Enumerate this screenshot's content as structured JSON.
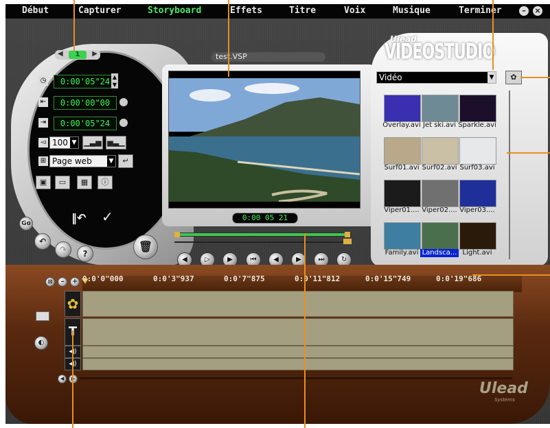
{
  "menu": {
    "items": [
      "Début",
      "Capturer",
      "Storyboard",
      "Effets",
      "Titre",
      "Voix",
      "Musique",
      "Terminer"
    ],
    "active": "Storyboard",
    "minimize_icon": "minimize-icon",
    "close_icon": "close-icon"
  },
  "project": {
    "filename": "test.VSP"
  },
  "controls": {
    "duration": "0:00'05\"24",
    "mark_in": "0:00'00\"00",
    "mark_out": "0:00'05\"24",
    "volume": "100",
    "output_select": "Page web"
  },
  "preview": {
    "timecode": "0:00 05 21"
  },
  "library": {
    "logo_top": "Ulead",
    "logo_main": "VIDEOSTUDIO",
    "category": "Vidéo",
    "items": [
      {
        "label": "Overlay.avi",
        "color": "#3a2fb0"
      },
      {
        "label": "Jet ski.avi",
        "color": "#6e8b95"
      },
      {
        "label": "Sparkle.avi",
        "color": "#1b0f2b"
      },
      {
        "label": "Surf01.avi",
        "color": "#b9a88a"
      },
      {
        "label": "Surf02.avi",
        "color": "#c9c0a6"
      },
      {
        "label": "Surf03.avi",
        "color": "#e6e8ea"
      },
      {
        "label": "Viper01....",
        "color": "#1b1b1b"
      },
      {
        "label": "Viper02....",
        "color": "#707070"
      },
      {
        "label": "Viper03....",
        "color": "#1f2f9a"
      },
      {
        "label": "Family.avi",
        "color": "#3e7ea0"
      },
      {
        "label": "Landsca...",
        "color": "#4a6f4c"
      },
      {
        "label": "Light.avi",
        "color": "#2a1a0a"
      }
    ],
    "selected_index": 10
  },
  "timeline": {
    "ticks": [
      "0:0'0\"000",
      "0:0'3\"937",
      "0:0'7\"875",
      "0:0'11\"812",
      "0:0'15\"749",
      "0:0'19\"686"
    ]
  },
  "brand": {
    "top": "Ulead",
    "bottom": "Systems"
  },
  "colors": {
    "active_menu": "#4fe86a",
    "timecode_green": "#3cf25a",
    "callout": "#e89020",
    "track": "#a59f82"
  }
}
